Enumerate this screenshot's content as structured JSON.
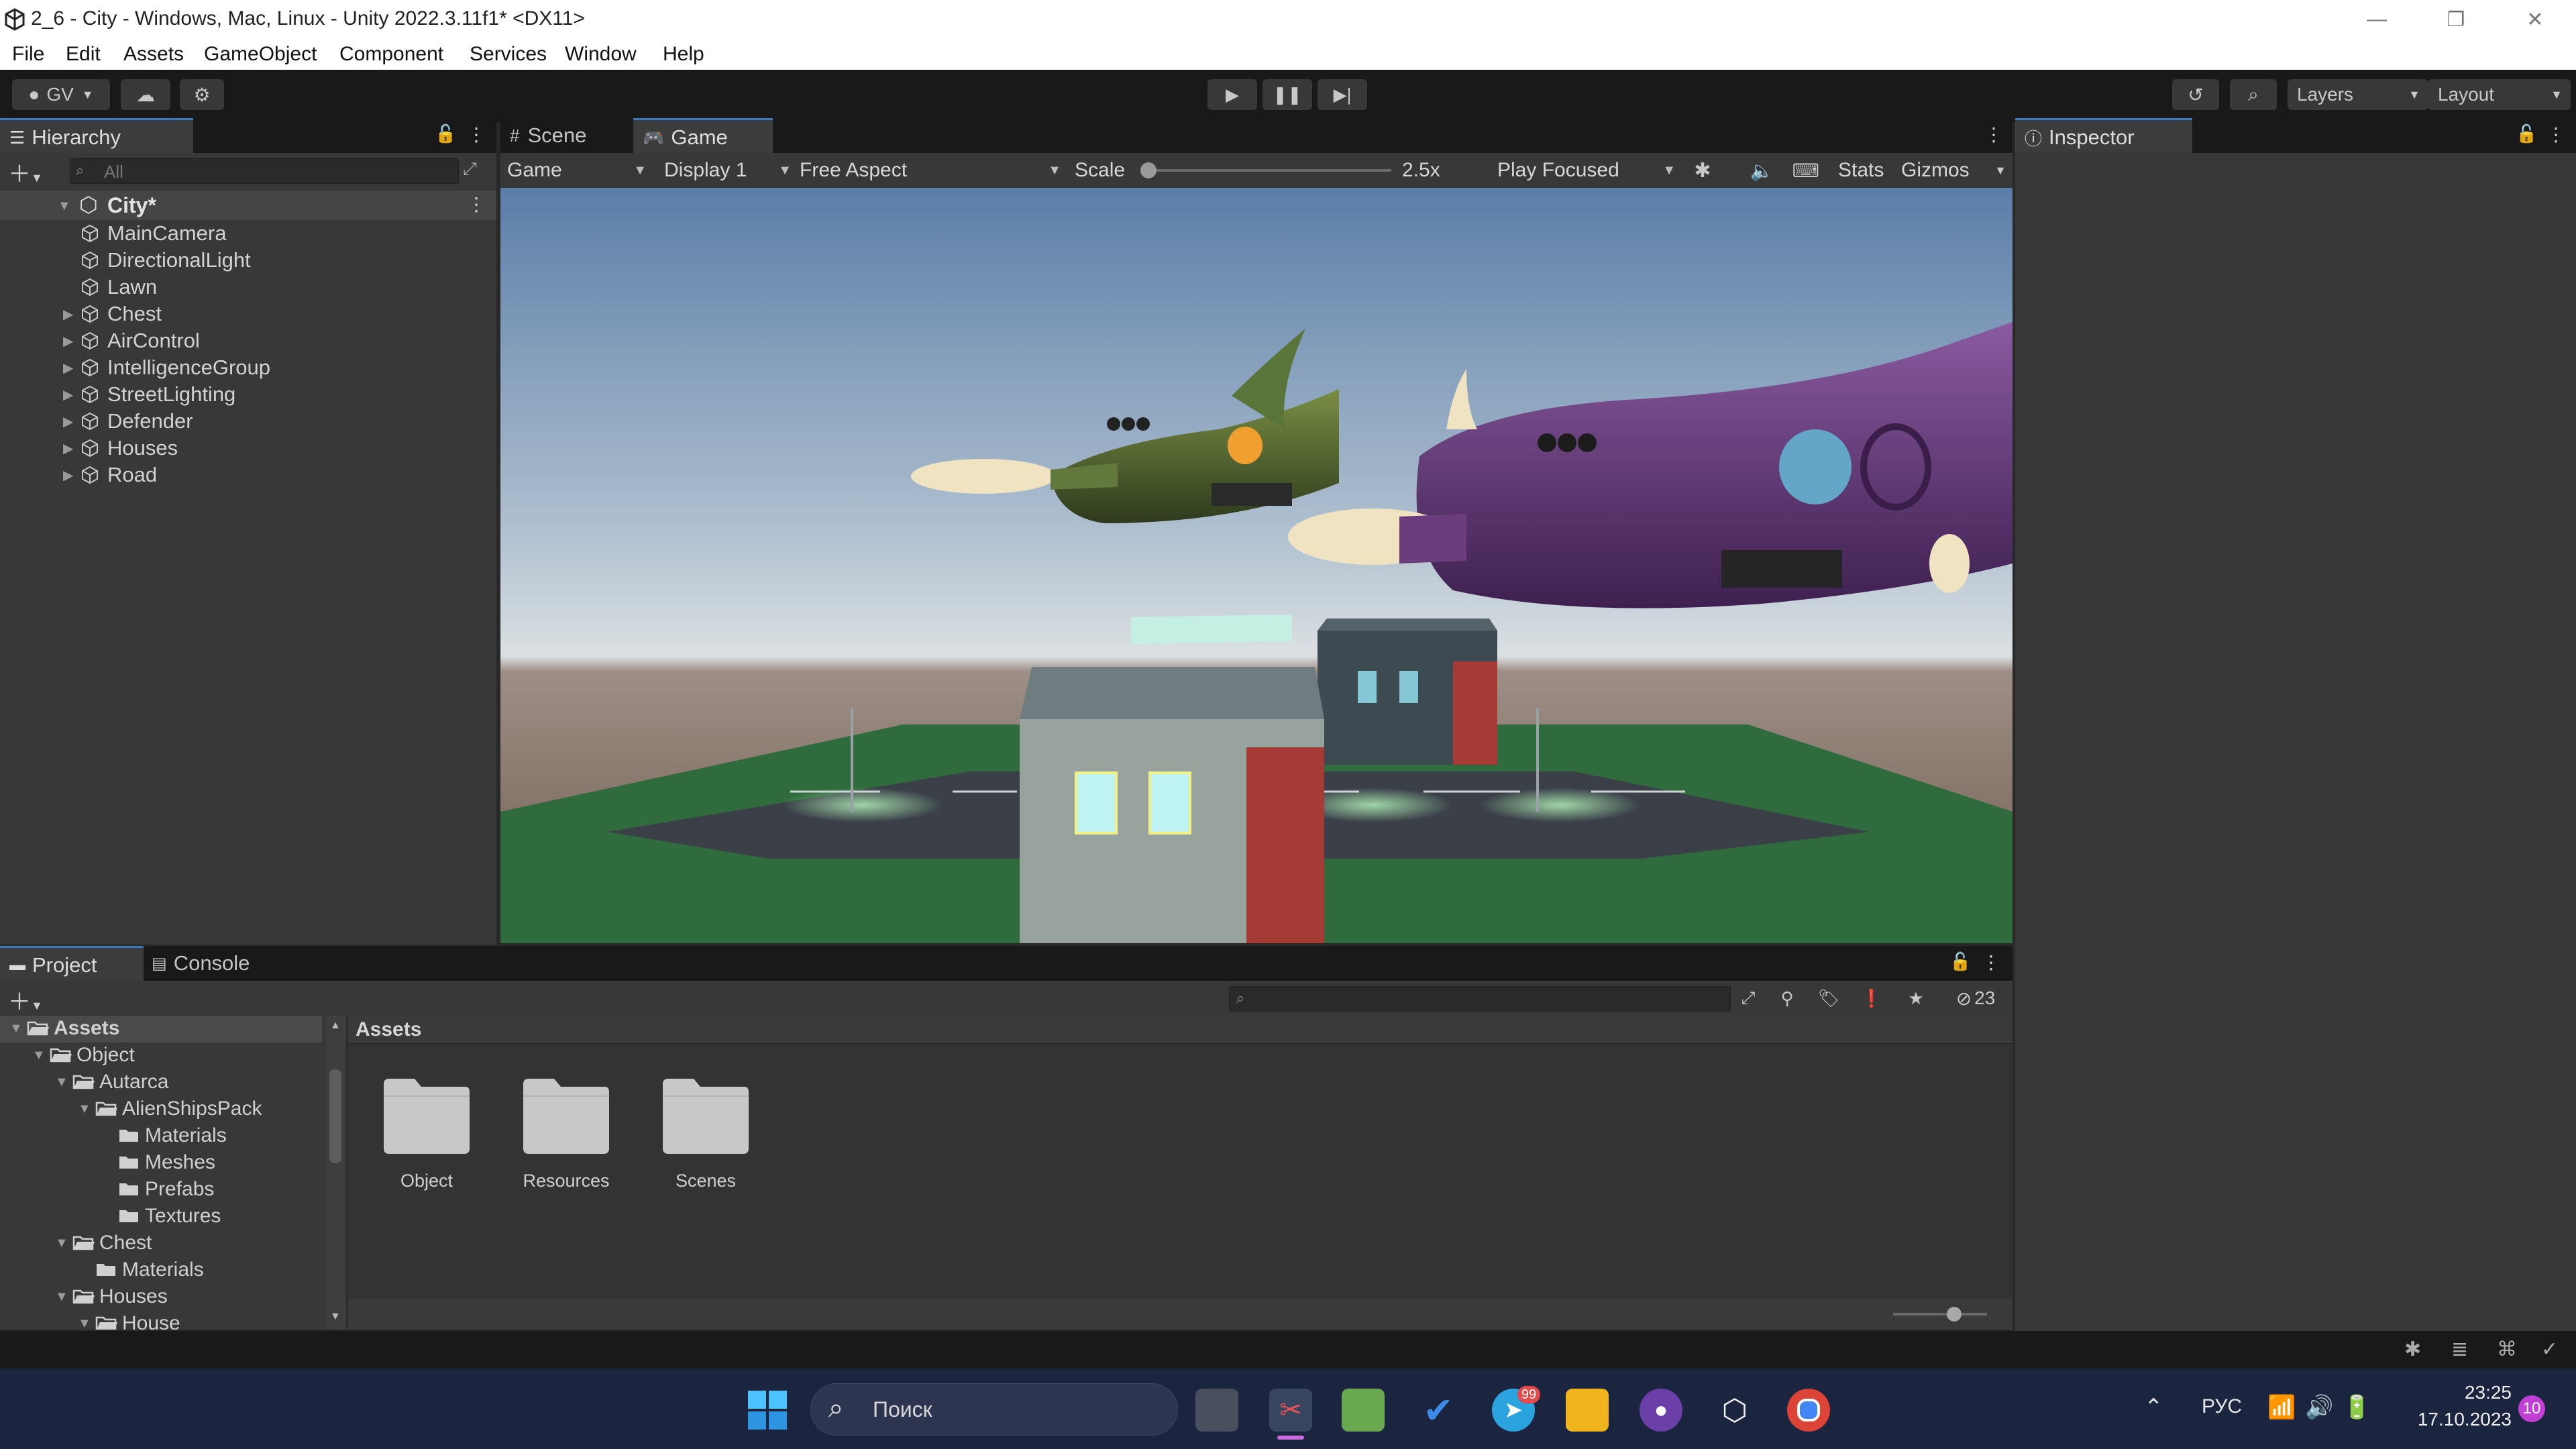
{
  "window": {
    "title": "2_6 - City - Windows, Mac, Linux - Unity 2022.3.11f1* <DX11>",
    "controls": [
      "—",
      "❐",
      "✕"
    ]
  },
  "menu": [
    "File",
    "Edit",
    "Assets",
    "GameObject",
    "Component",
    "Services",
    "Window",
    "Help"
  ],
  "toolbar": {
    "account": "GV",
    "layers": "Layers",
    "layout": "Layout"
  },
  "hierarchy": {
    "tab": "Hierarchy",
    "search_placeholder": "All",
    "scene": "City*",
    "items": [
      {
        "label": "MainCamera",
        "expandable": false
      },
      {
        "label": "DirectionalLight",
        "expandable": false
      },
      {
        "label": "Lawn",
        "expandable": false
      },
      {
        "label": "Chest",
        "expandable": true
      },
      {
        "label": "AirControl",
        "expandable": true
      },
      {
        "label": "IntelligenceGroup",
        "expandable": true
      },
      {
        "label": "StreetLighting",
        "expandable": true
      },
      {
        "label": "Defender",
        "expandable": true
      },
      {
        "label": "Houses",
        "expandable": true
      },
      {
        "label": "Road",
        "expandable": true
      }
    ]
  },
  "game": {
    "tabs": [
      "Scene",
      "Game"
    ],
    "mode": "Game",
    "display": "Display 1",
    "aspect": "Free Aspect",
    "scale_label": "Scale",
    "scale_value": "2.5x",
    "play_mode": "Play Focused",
    "stats": "Stats",
    "gizmos": "Gizmos"
  },
  "inspector": {
    "tab": "Inspector"
  },
  "project": {
    "tabs": [
      "Project",
      "Console"
    ],
    "hidden_count": "23",
    "breadcrumb": "Assets",
    "tree": [
      {
        "label": "Assets",
        "depth": 0,
        "open": true,
        "bold": true
      },
      {
        "label": "Object",
        "depth": 1,
        "open": true
      },
      {
        "label": "Autarca",
        "depth": 2,
        "open": true
      },
      {
        "label": "AlienShipsPack",
        "depth": 3,
        "open": true
      },
      {
        "label": "Materials",
        "depth": 4,
        "open": false
      },
      {
        "label": "Meshes",
        "depth": 4,
        "open": false
      },
      {
        "label": "Prefabs",
        "depth": 4,
        "open": false
      },
      {
        "label": "Textures",
        "depth": 4,
        "open": false
      },
      {
        "label": "Chest",
        "depth": 2,
        "open": true
      },
      {
        "label": "Materials",
        "depth": 3,
        "open": false
      },
      {
        "label": "Houses",
        "depth": 2,
        "open": true
      },
      {
        "label": "House",
        "depth": 3,
        "open": true
      }
    ],
    "folders": [
      "Object",
      "Resources",
      "Scenes"
    ]
  },
  "taskbar": {
    "search": "Поиск",
    "language": "РУС",
    "time": "23:25",
    "date": "17.10.2023",
    "notifications": "10",
    "telegram_badge": "99"
  },
  "colors": {
    "accent": "#3a79bb",
    "panel": "#282828",
    "taskbar": "#1c2540"
  }
}
